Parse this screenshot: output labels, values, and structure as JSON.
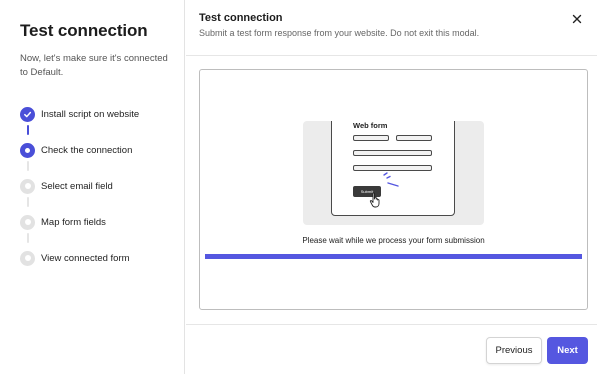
{
  "sidebar": {
    "title": "Test connection",
    "description": "Now, let's make sure it's connected to Default.",
    "steps": [
      {
        "label": "Install script on website",
        "status": "done"
      },
      {
        "label": "Check the connection",
        "status": "active"
      },
      {
        "label": "Select email field",
        "status": "pending"
      },
      {
        "label": "Map form fields",
        "status": "pending"
      },
      {
        "label": "View connected form",
        "status": "pending"
      }
    ]
  },
  "modal": {
    "title": "Test connection",
    "subtitle": "Submit a test form response from your website. Do not exit this modal.",
    "close_icon": "close-icon"
  },
  "illustration": {
    "form_title": "Web form",
    "submit_label": "Submit",
    "wait_message": "Please wait while we process your form submission",
    "progress": 1.0
  },
  "footer": {
    "previous_label": "Previous",
    "next_label": "Next"
  },
  "colors": {
    "accent": "#5557e0",
    "step_done": "#4a4fd8",
    "step_pending": "#e2e2e2"
  }
}
